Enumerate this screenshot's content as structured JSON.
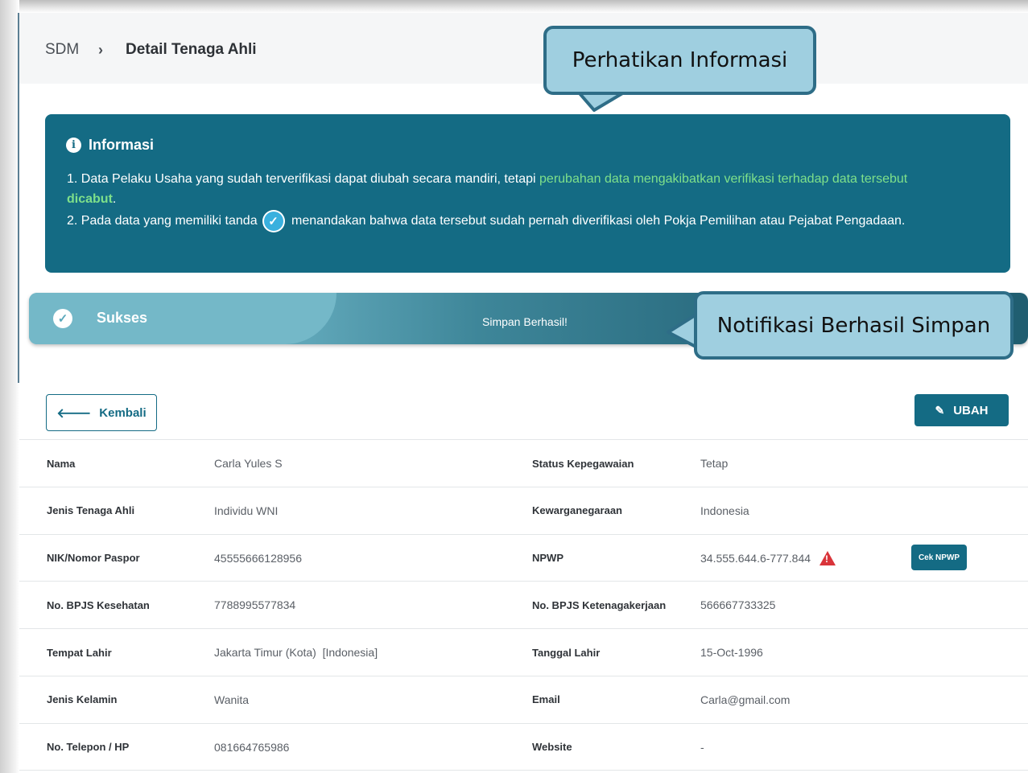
{
  "breadcrumb": {
    "root": "SDM",
    "separator": "›",
    "current": "Detail Tenaga Ahli"
  },
  "info": {
    "title": "Informasi",
    "line1_prefix": "1. Data Pelaku Usaha yang sudah terverifikasi dapat diubah secara mandiri, tetapi ",
    "line1_highlight": "perubahan data mengakibatkan verifikasi terhadap data tersebut",
    "line1_bold": "dicabut",
    "line1_suffix": ".",
    "line2_prefix": "2. Pada data yang memiliki tanda",
    "line2_suffix": "menandakan bahwa data tersebut sudah pernah diverifikasi oleh Pokja Pemilihan atau Pejabat Pengadaan."
  },
  "alert": {
    "title": "Sukses",
    "message": "Simpan Berhasil!"
  },
  "callouts": {
    "top": "Perhatikan Informasi",
    "success": "Notifikasi Berhasil Simpan"
  },
  "buttons": {
    "back": "Kembali",
    "edit": "UBAH",
    "check_npwp": "Cek NPWP"
  },
  "rows": [
    {
      "l1": "Nama",
      "v1": "Carla Yules S",
      "l2": "Status Kepegawaian",
      "v2": "Tetap"
    },
    {
      "l1": "Jenis Tenaga Ahli",
      "v1": "Individu WNI",
      "l2": "Kewarganegaraan",
      "v2": "Indonesia"
    },
    {
      "l1": "NIK/Nomor Paspor",
      "v1": "45555666128956",
      "l2": "NPWP",
      "v2": "34.555.644.6-777.844"
    },
    {
      "l1": "No. BPJS Kesehatan",
      "v1": "7788995577834",
      "l2": "No. BPJS Ketenagakerjaan",
      "v2": "566667733325"
    },
    {
      "l1": "Tempat Lahir",
      "v1": "Jakarta Timur (Kota)  [Indonesia]",
      "l2": "Tanggal Lahir",
      "v2": "15-Oct-1996"
    },
    {
      "l1": "Jenis Kelamin",
      "v1": "Wanita",
      "l2": "Email",
      "v2": "Carla@gmail.com"
    },
    {
      "l1": "No. Telepon / HP",
      "v1": "081664765986",
      "l2": "Website",
      "v2": "-"
    }
  ],
  "colors": {
    "primary": "#146b84",
    "highlight": "#7ee08a",
    "callout_fill": "#9fcfe0",
    "callout_border": "#2e6d87",
    "warning": "#d9343a"
  },
  "icons": {
    "info": "info-circle-icon",
    "verified": "check-circle-icon",
    "success": "check-circle-icon",
    "back": "arrow-left-icon",
    "edit": "edit-icon",
    "warning": "warning-triangle-icon"
  }
}
